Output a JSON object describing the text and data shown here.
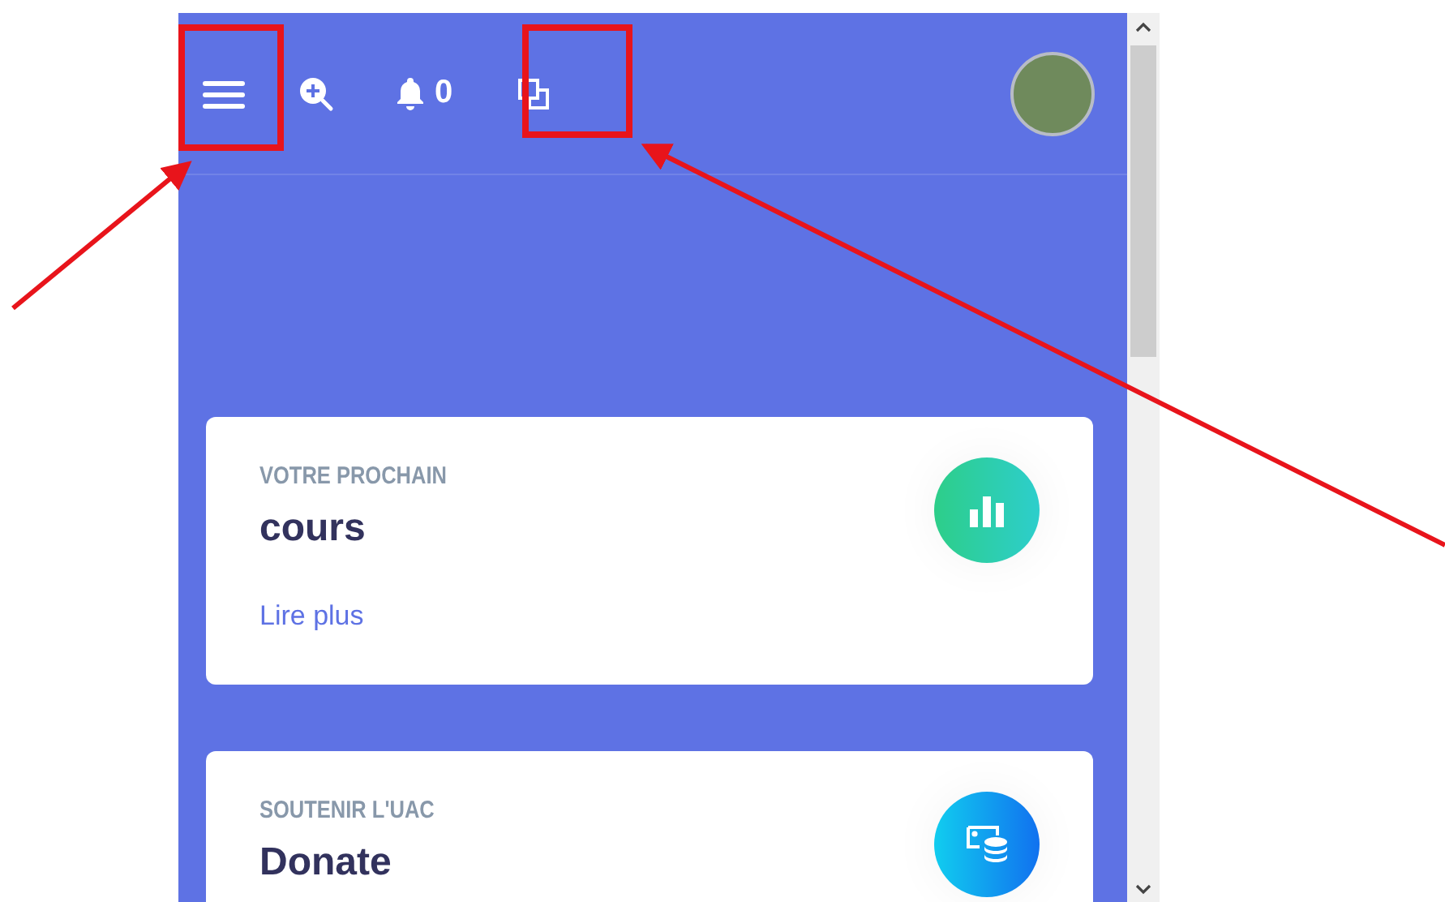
{
  "header": {
    "notification_count": "0"
  },
  "cards": [
    {
      "kind": "chart",
      "label": "VOTRE PROCHAIN",
      "title": "cours",
      "link": "Lire plus"
    },
    {
      "kind": "donate",
      "label": "SOUTENIR L'UAC",
      "title": "Donate"
    }
  ]
}
